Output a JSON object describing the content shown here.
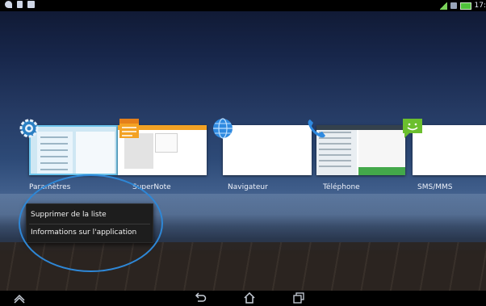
{
  "status_bar": {
    "left_icons": [
      "wifi-icon",
      "document-icon",
      "gallery-icon"
    ],
    "right_icons": [
      "signal-icon",
      "sim-icon",
      "battery-icon"
    ],
    "clock": "17:"
  },
  "recents": [
    {
      "label": "Paramètres",
      "icon": "settings-gear-icon"
    },
    {
      "label": "SuperNote",
      "icon": "supernote-icon"
    },
    {
      "label": "Navigateur",
      "icon": "globe-icon"
    },
    {
      "label": "Téléphone",
      "icon": "phone-icon"
    },
    {
      "label": "SMS/MMS",
      "icon": "sms-smiley-icon"
    }
  ],
  "context_menu": {
    "items": [
      "Supprimer de la liste",
      "Informations sur l'application"
    ]
  },
  "nav_bar": {
    "icons": [
      "up-arrow-icon",
      "back-icon",
      "home-icon",
      "recent-apps-icon"
    ]
  },
  "colors": {
    "highlight": "#2e87d6",
    "menu_bg": "#1d1d1d",
    "supernote_orange": "#f3a224",
    "sms_green": "#6bbf2e",
    "globe_blue": "#2f8ae0"
  }
}
